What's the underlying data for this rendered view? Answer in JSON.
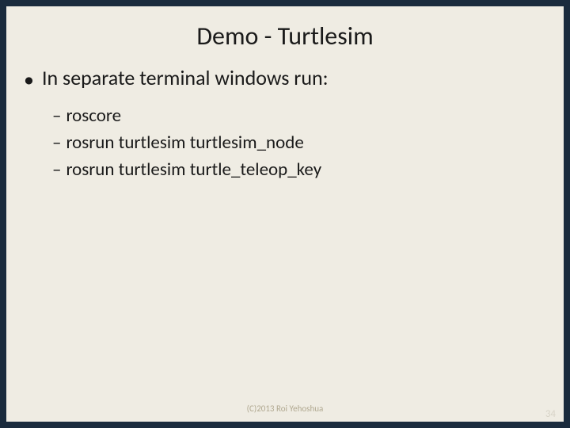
{
  "title": "Demo - Turtlesim",
  "bullet": "In separate terminal windows run:",
  "subbullets": [
    "roscore",
    "rosrun turtlesim turtlesim_node",
    "rosrun turtlesim turtle_teleop_key"
  ],
  "copyright": "(C)2013 Roi Yehoshua",
  "pageNumber": "34"
}
